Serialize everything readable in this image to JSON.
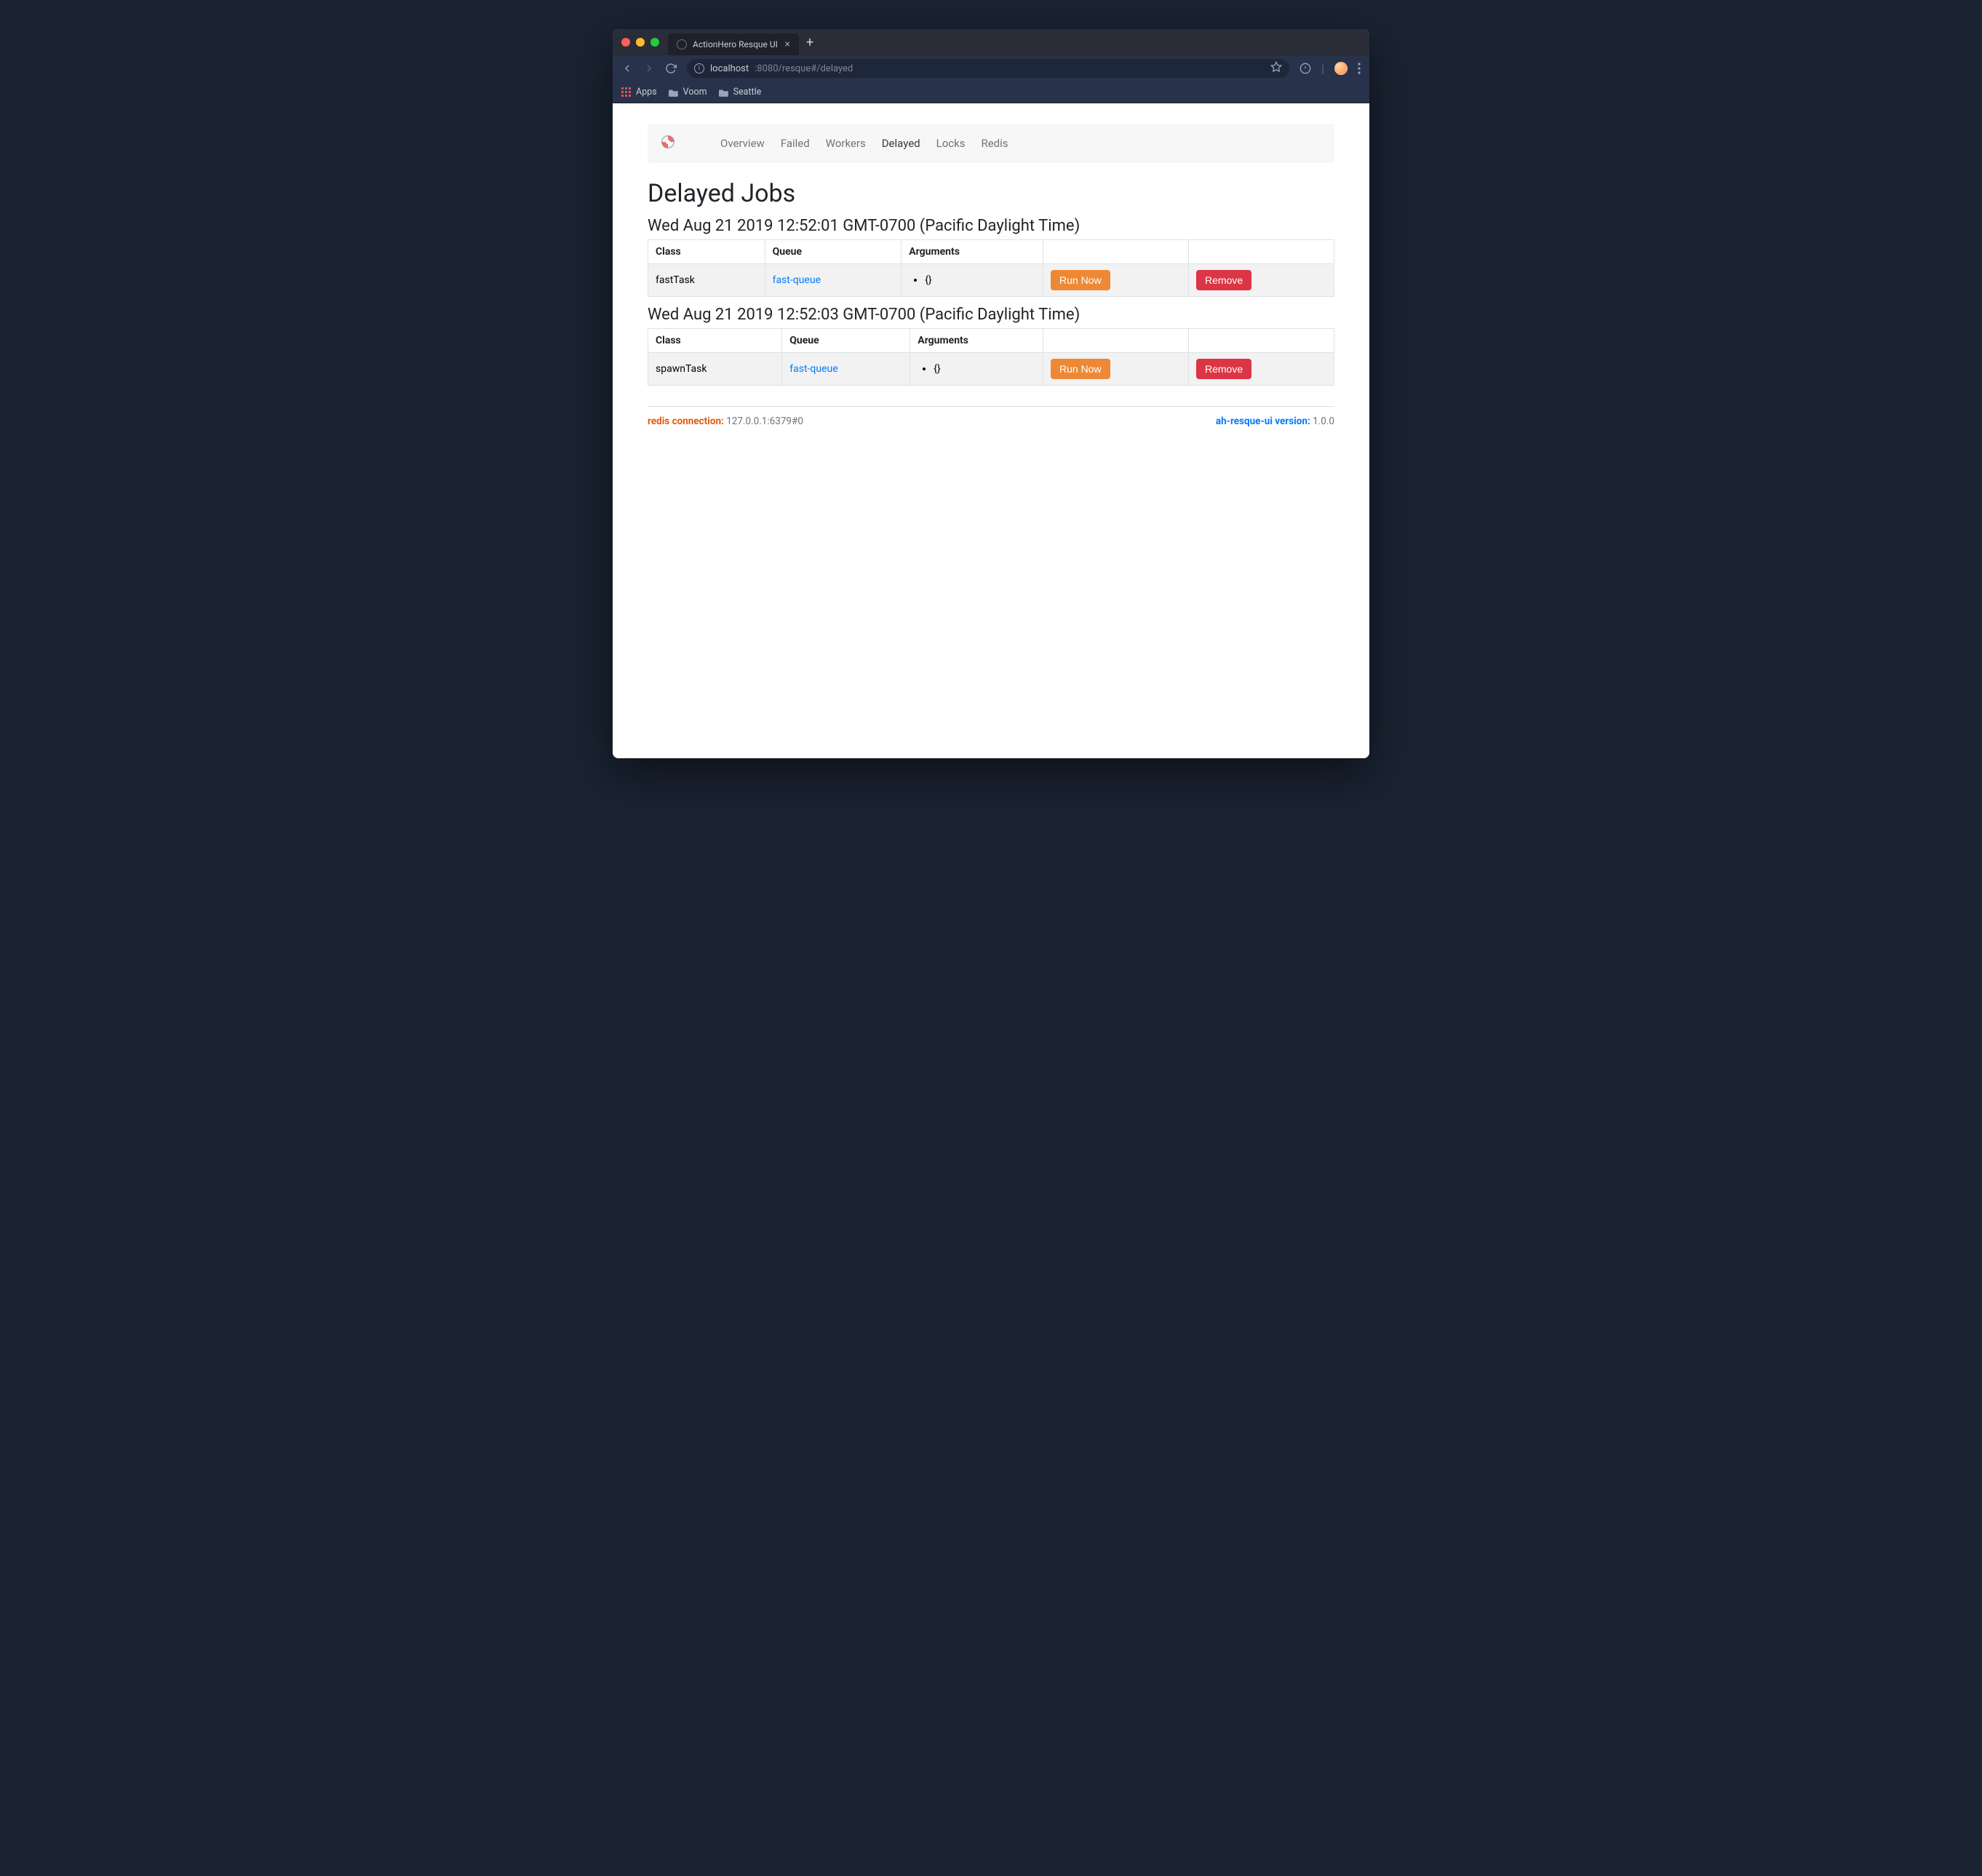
{
  "browser": {
    "tab_title": "ActionHero Resque UI",
    "url_prefix": "localhost",
    "url_suffix": ":8080/resque#/delayed",
    "bookmarks": {
      "apps": "Apps",
      "voom": "Voom",
      "seattle": "Seattle"
    }
  },
  "nav": {
    "items": [
      {
        "label": "Overview",
        "active": false
      },
      {
        "label": "Failed",
        "active": false
      },
      {
        "label": "Workers",
        "active": false
      },
      {
        "label": "Delayed",
        "active": true
      },
      {
        "label": "Locks",
        "active": false
      },
      {
        "label": "Redis",
        "active": false
      }
    ]
  },
  "page_title": "Delayed Jobs",
  "table_headers": {
    "class": "Class",
    "queue": "Queue",
    "arguments": "Arguments"
  },
  "buttons": {
    "run_now": "Run Now",
    "remove": "Remove"
  },
  "groups": [
    {
      "timestamp": "Wed Aug 21 2019 12:52:01 GMT-0700 (Pacific Daylight Time)",
      "jobs": [
        {
          "class": "fastTask",
          "queue": "fast-queue",
          "args": "{}"
        }
      ]
    },
    {
      "timestamp": "Wed Aug 21 2019 12:52:03 GMT-0700 (Pacific Daylight Time)",
      "jobs": [
        {
          "class": "spawnTask",
          "queue": "fast-queue",
          "args": "{}"
        }
      ]
    }
  ],
  "footer": {
    "redis_label": "redis connection:",
    "redis_value": "127.0.0.1:6379#0",
    "version_label": "ah-resque-ui version:",
    "version_value": "1.0.0"
  }
}
